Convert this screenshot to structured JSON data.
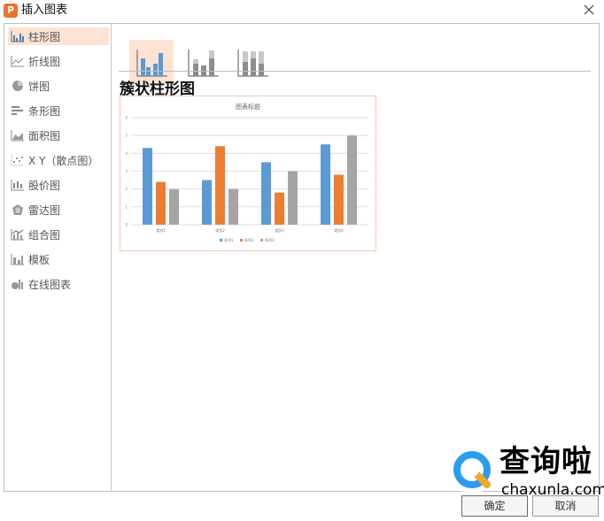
{
  "window": {
    "title": "插入图表",
    "app_icon_glyph": "P",
    "app_icon_color": "#f0702d",
    "close_icon": "close-icon"
  },
  "sidebar": {
    "items": [
      {
        "label": "柱形图",
        "icon": "column-chart-icon",
        "active": true
      },
      {
        "label": "折线图",
        "icon": "line-chart-icon",
        "active": false
      },
      {
        "label": "饼图",
        "icon": "pie-chart-icon",
        "active": false
      },
      {
        "label": "条形图",
        "icon": "bar-chart-icon",
        "active": false
      },
      {
        "label": "面积图",
        "icon": "area-chart-icon",
        "active": false
      },
      {
        "label": "X Y（散点图）",
        "icon": "scatter-chart-icon",
        "active": false
      },
      {
        "label": "股价图",
        "icon": "stock-chart-icon",
        "active": false
      },
      {
        "label": "雷达图",
        "icon": "radar-chart-icon",
        "active": false
      },
      {
        "label": "组合图",
        "icon": "combo-chart-icon",
        "active": false
      },
      {
        "label": "模板",
        "icon": "template-icon",
        "active": false
      },
      {
        "label": "在线图表",
        "icon": "online-chart-icon",
        "active": false
      }
    ]
  },
  "subtypes": [
    {
      "name": "clustered-column",
      "active": true
    },
    {
      "name": "stacked-column",
      "active": false
    },
    {
      "name": "percent-stacked-column",
      "active": false
    }
  ],
  "main": {
    "heading": "簇状柱形图"
  },
  "chart_data": {
    "type": "bar",
    "title": "图表标题",
    "categories": [
      "类别1",
      "类别2",
      "类别3",
      "类别4"
    ],
    "series": [
      {
        "name": "系列1",
        "values": [
          4.3,
          2.5,
          3.5,
          4.5
        ],
        "color": "#5b9bd5"
      },
      {
        "name": "系列2",
        "values": [
          2.4,
          4.4,
          1.8,
          2.8
        ],
        "color": "#ed7d31"
      },
      {
        "name": "系列3",
        "values": [
          2,
          2,
          3,
          5
        ],
        "color": "#a5a5a5"
      }
    ],
    "yticks": [
      "0",
      "1",
      "2",
      "3",
      "4",
      "5",
      "6"
    ],
    "ylim": [
      0,
      6
    ],
    "grid": true,
    "legend": "bottom"
  },
  "buttons": {
    "ok": "确定",
    "cancel": "取消"
  },
  "watermark": {
    "text": "查询啦",
    "domain": "chaxunla.com"
  }
}
